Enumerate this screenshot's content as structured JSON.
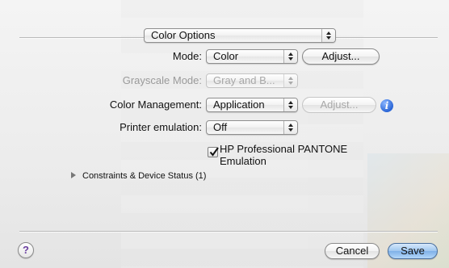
{
  "section_popup": {
    "selected": "Color Options"
  },
  "mode": {
    "label": "Mode:",
    "selected": "Color",
    "adjust_label": "Adjust..."
  },
  "grayscale_mode": {
    "label": "Grayscale Mode:",
    "selected": "Gray and B..."
  },
  "color_management": {
    "label": "Color Management:",
    "selected": "Application",
    "adjust_label": "Adjust..."
  },
  "printer_emulation": {
    "label": "Printer emulation:",
    "selected": "Off"
  },
  "pantone": {
    "label_line1": "HP Professional PANTONE",
    "label_line2": "Emulation",
    "checked": true
  },
  "disclosure": {
    "label": "Constraints & Device Status (1)"
  },
  "footer": {
    "help_glyph": "?",
    "cancel_label": "Cancel",
    "save_label": "Save"
  },
  "icons": {
    "info": "info-icon",
    "help": "help-icon",
    "popup_arrows": "updown-arrows-icon",
    "disclosure": "disclosure-triangle-icon"
  },
  "colors": {
    "accent": "#2b66d6",
    "default_button": "#9fc6ef"
  }
}
